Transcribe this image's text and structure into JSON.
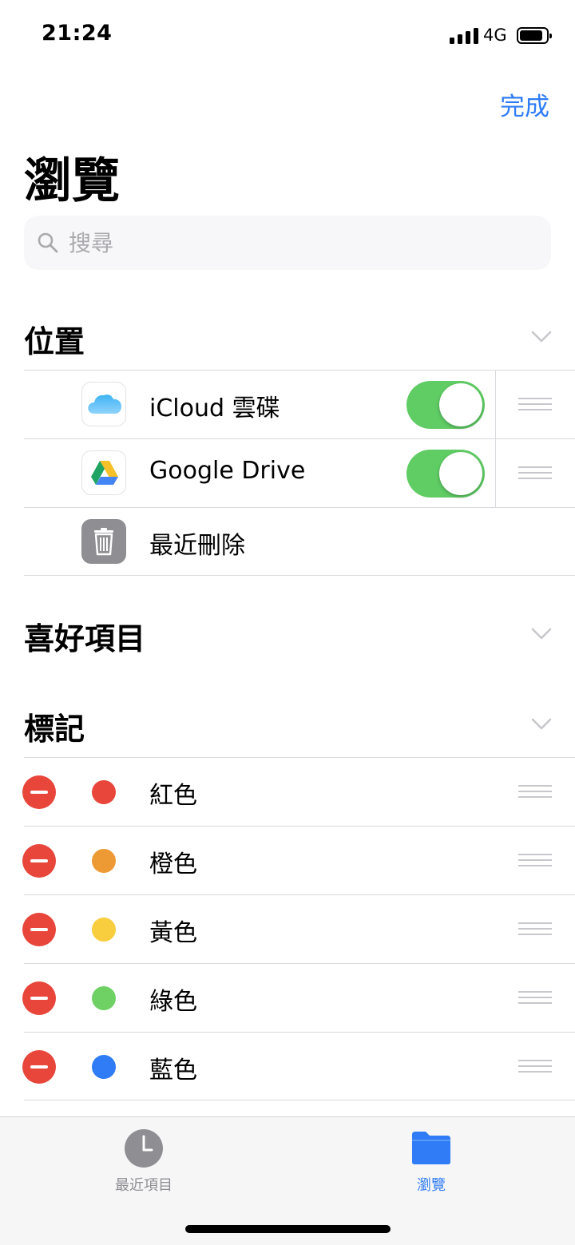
{
  "status_bar": {
    "time": "21:24",
    "network": "4G"
  },
  "header": {
    "done_label": "完成",
    "title": "瀏覽"
  },
  "search": {
    "placeholder": "搜尋"
  },
  "sections": {
    "locations": {
      "title": "位置",
      "items": [
        {
          "label": "iCloud 雲碟",
          "icon": "icloud-icon",
          "enabled": true
        },
        {
          "label": "Google Drive",
          "icon": "google-drive-icon",
          "enabled": true
        },
        {
          "label": "最近刪除",
          "icon": "trash-icon"
        }
      ]
    },
    "favorites": {
      "title": "喜好項目"
    },
    "tags": {
      "title": "標記",
      "items": [
        {
          "label": "紅色",
          "color": "#e8463b"
        },
        {
          "label": "橙色",
          "color": "#ee9a34"
        },
        {
          "label": "黃色",
          "color": "#f8cd3e"
        },
        {
          "label": "綠色",
          "color": "#6fd164"
        },
        {
          "label": "藍色",
          "color": "#2f7cf6"
        }
      ]
    }
  },
  "tab_bar": {
    "tabs": [
      {
        "label": "最近項目",
        "icon": "clock-icon",
        "active": false,
        "color": "#8e8e93"
      },
      {
        "label": "瀏覽",
        "icon": "folder-icon",
        "active": true,
        "color": "#2f7cf6"
      }
    ]
  }
}
